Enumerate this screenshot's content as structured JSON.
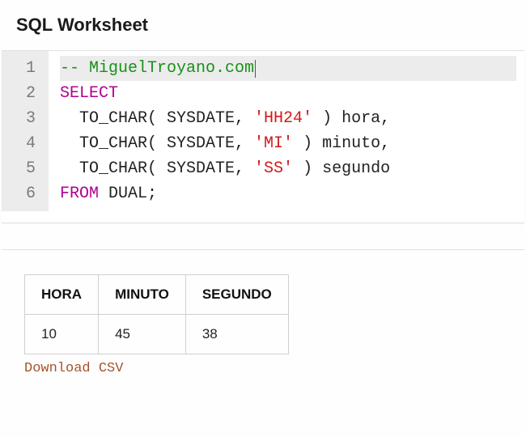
{
  "header": {
    "title": "SQL Worksheet"
  },
  "editor": {
    "lines": [
      {
        "n": 1,
        "tokens": [
          {
            "cls": "tok-comment",
            "t": "-- MiguelTroyano.com"
          }
        ],
        "cursorAfter": true,
        "active": true
      },
      {
        "n": 2,
        "tokens": [
          {
            "cls": "tok-keyword",
            "t": "SELECT"
          }
        ]
      },
      {
        "n": 3,
        "tokens": [
          {
            "cls": "tok-plain",
            "t": "  TO_CHAR( SYSDATE, "
          },
          {
            "cls": "tok-string",
            "t": "'HH24'"
          },
          {
            "cls": "tok-plain",
            "t": " ) hora,"
          }
        ]
      },
      {
        "n": 4,
        "tokens": [
          {
            "cls": "tok-plain",
            "t": "  TO_CHAR( SYSDATE, "
          },
          {
            "cls": "tok-string",
            "t": "'MI'"
          },
          {
            "cls": "tok-plain",
            "t": " ) minuto,"
          }
        ]
      },
      {
        "n": 5,
        "tokens": [
          {
            "cls": "tok-plain",
            "t": "  TO_CHAR( SYSDATE, "
          },
          {
            "cls": "tok-string",
            "t": "'SS'"
          },
          {
            "cls": "tok-plain",
            "t": " ) segundo"
          }
        ]
      },
      {
        "n": 6,
        "tokens": [
          {
            "cls": "tok-keyword",
            "t": "FROM"
          },
          {
            "cls": "tok-plain",
            "t": " DUAL;"
          }
        ]
      }
    ]
  },
  "results": {
    "columns": [
      "HORA",
      "MINUTO",
      "SEGUNDO"
    ],
    "rows": [
      [
        "10",
        "45",
        "38"
      ]
    ],
    "download_label": "Download CSV"
  }
}
